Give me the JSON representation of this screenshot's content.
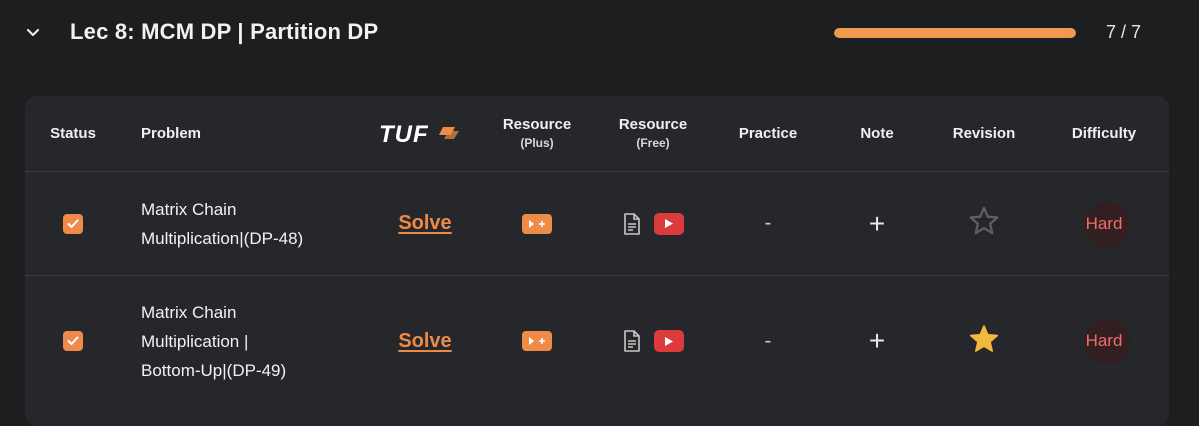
{
  "section": {
    "title": "Lec 8: MCM DP | Partition DP",
    "progress_fraction": 1.0,
    "progress_text": "7 / 7",
    "progress_color": "#ef9a4f",
    "accent_color": "#ee8c47"
  },
  "table": {
    "headers": {
      "status": "Status",
      "problem": "Problem",
      "tuf_logo": "TUF",
      "resource_plus": "Resource",
      "resource_plus_sub": "(Plus)",
      "resource_free": "Resource",
      "resource_free_sub": "(Free)",
      "practice": "Practice",
      "note": "Note",
      "revision": "Revision",
      "difficulty": "Difficulty"
    },
    "rows": [
      {
        "checked": true,
        "problem_lines": [
          "Matrix Chain",
          "Multiplication|(DP-48)"
        ],
        "solve": "Solve",
        "practice": "-",
        "note": "+",
        "revision_starred": false,
        "difficulty": "Hard"
      },
      {
        "checked": true,
        "problem_lines": [
          "Matrix Chain",
          "Multiplication |",
          "Bottom-Up|(DP-49)"
        ],
        "solve": "Solve",
        "practice": "-",
        "note": "+",
        "revision_starred": true,
        "difficulty": "Hard"
      }
    ]
  },
  "icons": {
    "collapse": "chevron-down-icon",
    "checkbox": "checkbox-checked-icon",
    "resource_plus": "video-plus-icon",
    "article": "document-icon",
    "youtube": "youtube-icon",
    "star_empty": "star-outline-icon",
    "star_filled": "star-filled-icon"
  },
  "colors": {
    "star_filled": "#f0b93d",
    "youtube": "#dd3b3b",
    "difficulty_hard": "#f26d63"
  }
}
